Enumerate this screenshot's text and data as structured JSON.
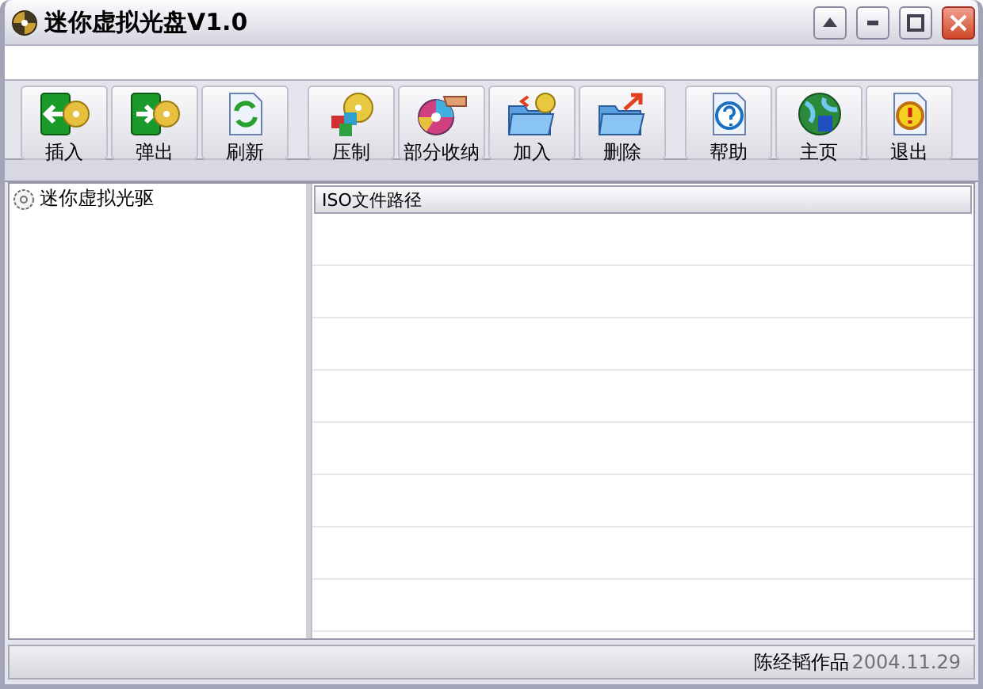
{
  "window": {
    "title": "迷你虚拟光盘V1.0"
  },
  "toolbar": {
    "groups": [
      [
        {
          "label": "插入",
          "kind": "insert"
        },
        {
          "label": "弹出",
          "kind": "eject"
        },
        {
          "label": "刷新",
          "kind": "refresh"
        }
      ],
      [
        {
          "label": "压制",
          "kind": "burn"
        },
        {
          "label": "部分收纳",
          "kind": "partial"
        },
        {
          "label": "加入",
          "kind": "add"
        },
        {
          "label": "删除",
          "kind": "remove"
        }
      ],
      [
        {
          "label": "帮助",
          "kind": "help"
        },
        {
          "label": "主页",
          "kind": "home"
        },
        {
          "label": "退出",
          "kind": "exit"
        }
      ]
    ]
  },
  "tree": {
    "items": [
      {
        "label": "迷你虚拟光驱"
      }
    ]
  },
  "table": {
    "columns": [
      "ISO文件路径"
    ]
  },
  "status_bar": {
    "author": "陈经韬作品",
    "date": "2004.11.29"
  }
}
